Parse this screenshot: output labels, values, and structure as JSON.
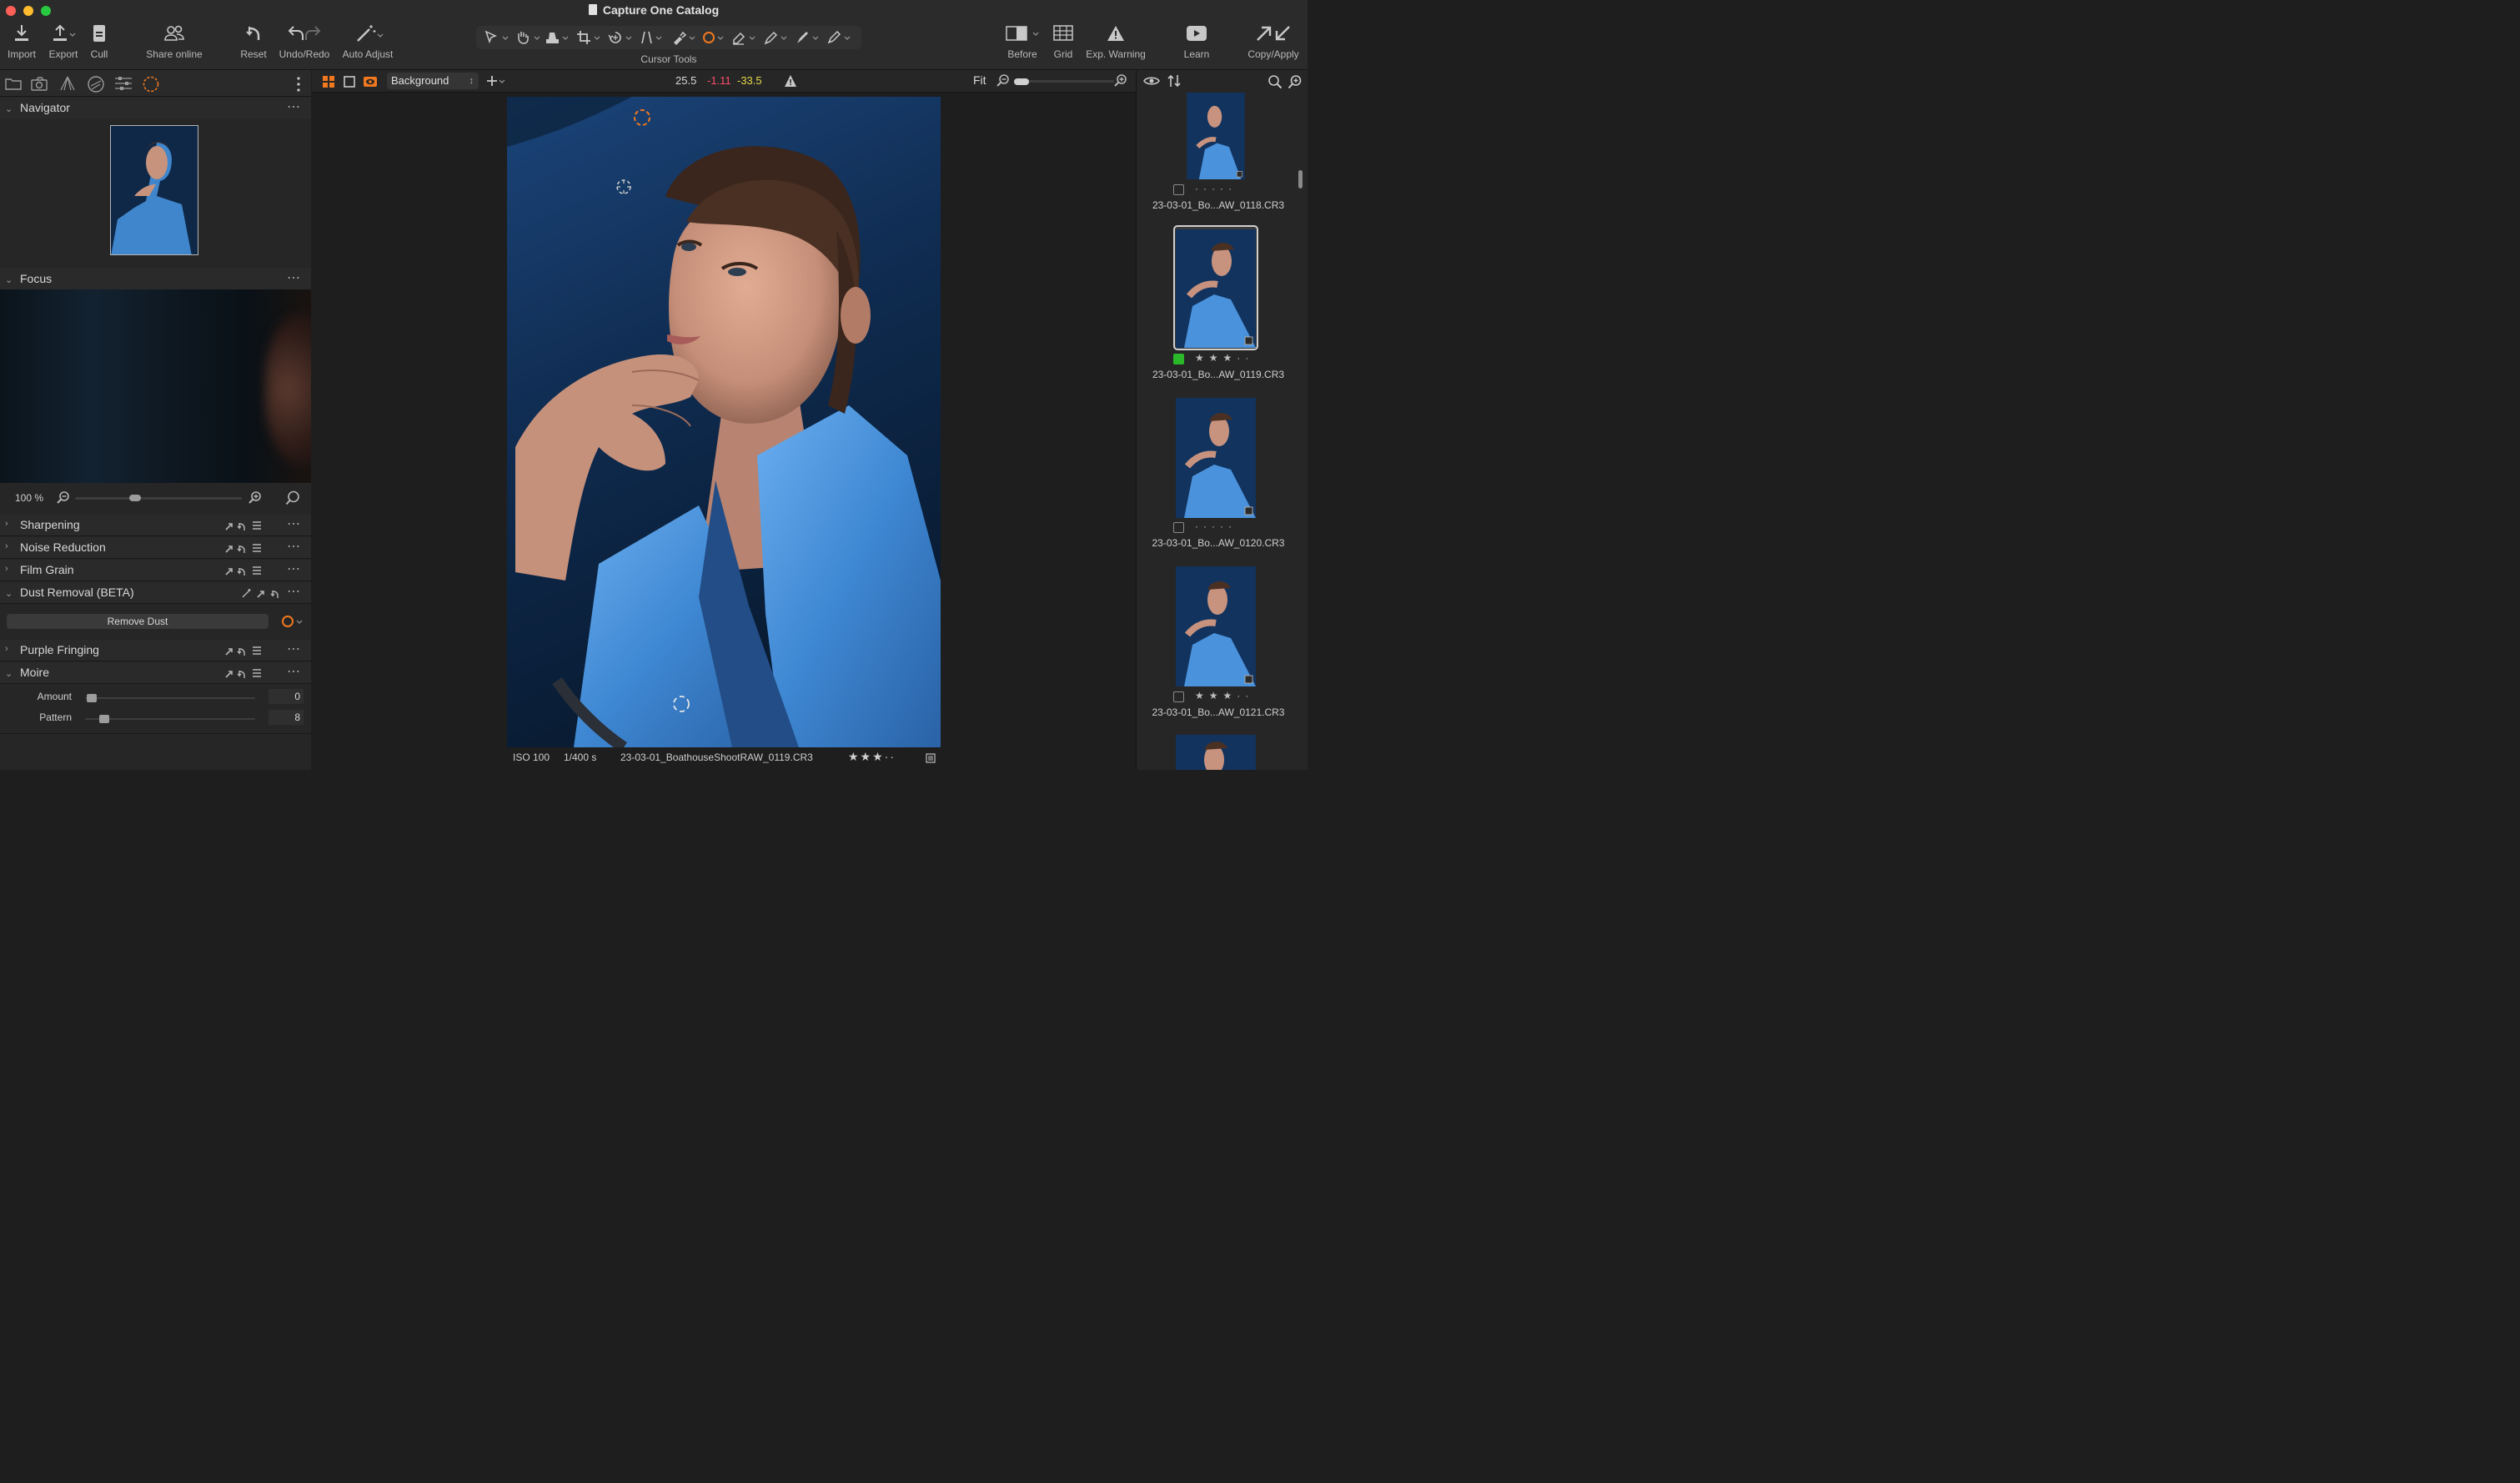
{
  "app": {
    "title": "Capture One Catalog",
    "accent_color": "#f0781e",
    "traffic_lights": [
      "#fe5f57",
      "#febc2e",
      "#28c840"
    ]
  },
  "toolbar": {
    "import_label": "Import",
    "export_label": "Export",
    "cull_label": "Cull",
    "share_label": "Share online",
    "reset_label": "Reset",
    "undoredo_label": "Undo/Redo",
    "autoadjust_label": "Auto Adjust",
    "cursor_tools_label": "Cursor Tools",
    "before_label": "Before",
    "grid_label": "Grid",
    "expwarning_label": "Exp. Warning",
    "learn_label": "Learn",
    "copyapply_label": "Copy/Apply"
  },
  "left_panel": {
    "navigator": {
      "title": "Navigator"
    },
    "focus": {
      "title": "Focus",
      "zoom_level": "100 %",
      "zoom_fraction": 0.35
    },
    "sections": {
      "sharpening": "Sharpening",
      "noise_reduction": "Noise Reduction",
      "film_grain": "Film Grain",
      "dust_removal": "Dust Removal (BETA)",
      "purple_fringing": "Purple Fringing",
      "moire": "Moire"
    },
    "remove_dust_button": "Remove Dust",
    "moire": {
      "amount_label": "Amount",
      "amount_value": "0",
      "pattern_label": "Pattern",
      "pattern_value": "8"
    }
  },
  "viewer": {
    "layer_select": "Background",
    "readout_1": "25.5",
    "readout_2": "-1.11",
    "readout_3": "-33.5",
    "fit_label": "Fit",
    "meta": {
      "iso": "ISO 100",
      "shutter": "1/400 s",
      "filename": "23-03-01_BoathouseShootRAW_0119.CR3",
      "rating_stars": 3
    }
  },
  "browser": {
    "thumbnails": [
      {
        "name": "23-03-01_Bo...AW_0118.CR3",
        "stars": 0,
        "color_tag": "",
        "selected": false
      },
      {
        "name": "23-03-01_Bo...AW_0119.CR3",
        "stars": 3,
        "color_tag": "#2ab82a",
        "selected": true
      },
      {
        "name": "23-03-01_Bo...AW_0120.CR3",
        "stars": 0,
        "color_tag": "",
        "selected": false
      },
      {
        "name": "23-03-01_Bo...AW_0121.CR3",
        "stars": 3,
        "color_tag": "",
        "selected": false
      }
    ]
  }
}
